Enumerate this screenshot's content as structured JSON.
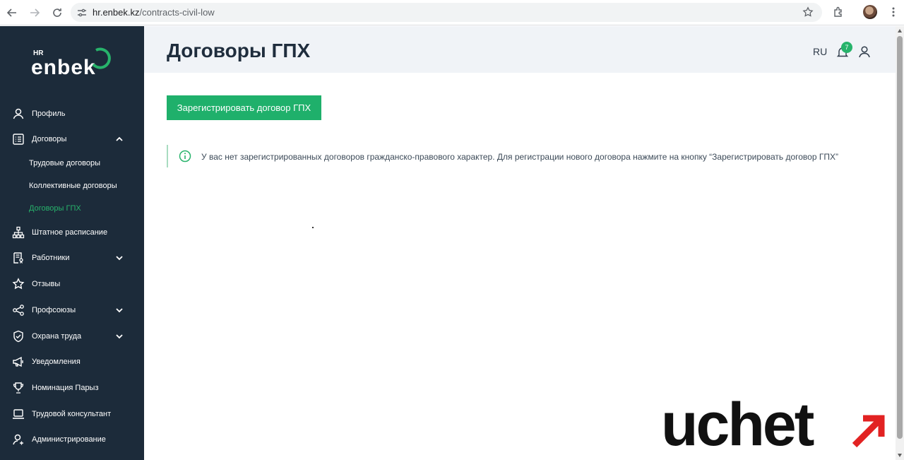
{
  "browser": {
    "url_host": "hr.enbek.kz",
    "url_path": "/contracts-civil-low"
  },
  "logo": {
    "hr": "HR",
    "word": "enbek"
  },
  "sidebar": {
    "items": [
      {
        "label": "Профиль",
        "icon": "user-icon"
      },
      {
        "label": "Договоры",
        "icon": "list-icon",
        "expanded": true
      },
      {
        "label": "Штатное расписание",
        "icon": "hierarchy-icon"
      },
      {
        "label": "Работники",
        "icon": "worker-doc-icon",
        "expandable": true
      },
      {
        "label": "Отзывы",
        "icon": "star-icon"
      },
      {
        "label": "Профсоюзы",
        "icon": "share-icon",
        "expandable": true
      },
      {
        "label": "Охрана труда",
        "icon": "shield-icon",
        "expandable": true
      },
      {
        "label": "Уведомления",
        "icon": "megaphone-icon"
      },
      {
        "label": "Номинация Парыз",
        "icon": "trophy-icon"
      },
      {
        "label": "Трудовой консультант",
        "icon": "laptop-icon"
      },
      {
        "label": "Администрирование",
        "icon": "admin-icon"
      }
    ],
    "subitems": [
      {
        "label": "Трудовые договоры"
      },
      {
        "label": "Коллективные договоры"
      },
      {
        "label": "Договоры ГПХ",
        "active": true
      }
    ]
  },
  "header": {
    "title": "Договоры ГПХ",
    "lang": "RU",
    "notifications_count": "7"
  },
  "main": {
    "register_button": "Зарегистрировать договор ГПХ",
    "notice": "У вас нет зарегистрированных договоров гражданско-правового характер. Для регистрации нового договора нажмите на кнопку “Зарегистрировать договор ГПХ”"
  },
  "watermark": {
    "text": "uchet"
  },
  "colors": {
    "sidebar_bg": "#1c2b3a",
    "accent": "#1fb06b",
    "header_bg": "#f0f3f7"
  }
}
